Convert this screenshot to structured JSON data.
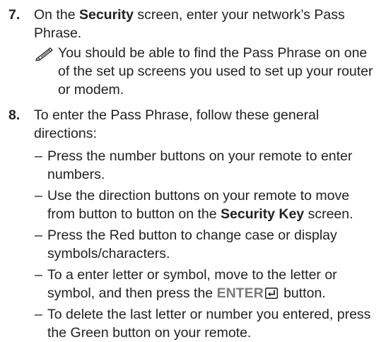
{
  "steps": [
    {
      "number": "7.",
      "pre": "On the ",
      "bold": "Security",
      "post": " screen, enter your network’s Pass Phrase.",
      "note": "You should be able to find the Pass Phrase on one of the set up screens you used to set up your router or modem."
    },
    {
      "number": "8.",
      "text": "To enter the Pass Phrase, follow these general directions:",
      "bullets": [
        {
          "text": "Press the number buttons on your remote to enter numbers."
        },
        {
          "pre": "Use the direction buttons on your remote to move from button to button on the ",
          "bold": "Security Key",
          "post": " screen."
        },
        {
          "text": "Press the Red button to change case or display symbols/characters."
        },
        {
          "pre": "To a enter letter or symbol, move to the letter or symbol, and then press the ",
          "key": "ENTER",
          "post": " button."
        },
        {
          "text": "To delete the last letter or number you entered, press the Green button on your remote."
        }
      ]
    }
  ],
  "icons": {
    "note": "pencil-note-icon",
    "enter": "enter-key-icon"
  },
  "colors": {
    "text": "#231f20",
    "enter_label": "#7a7a7a"
  }
}
